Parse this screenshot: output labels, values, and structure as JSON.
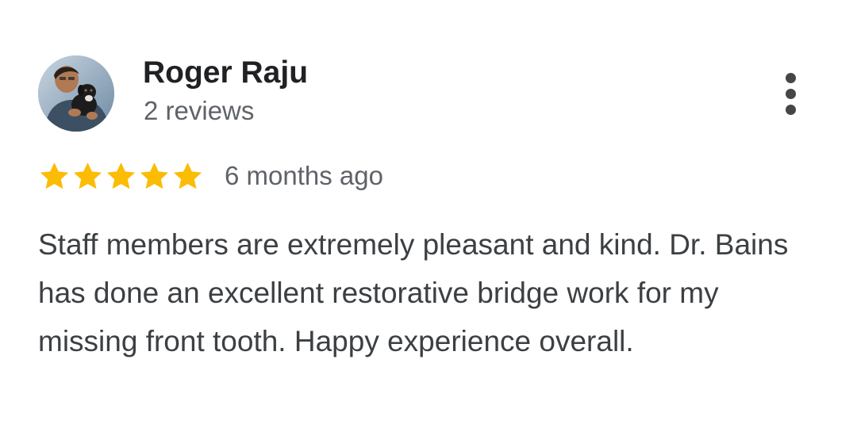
{
  "review": {
    "reviewer": {
      "name": "Roger Raju",
      "meta": "2 reviews",
      "avatar_icon": "user-photo-avatar"
    },
    "rating": {
      "stars": 5,
      "max_stars": 5,
      "star_icon": "star-icon",
      "star_color": "#fbbc04"
    },
    "date": "6 months ago",
    "text": "Staff members are extremely pleasant and kind. Dr. Bains has done an excellent restorative bridge work for my missing front tooth. Happy experience overall.",
    "more_options_icon": "more-vert-icon"
  }
}
